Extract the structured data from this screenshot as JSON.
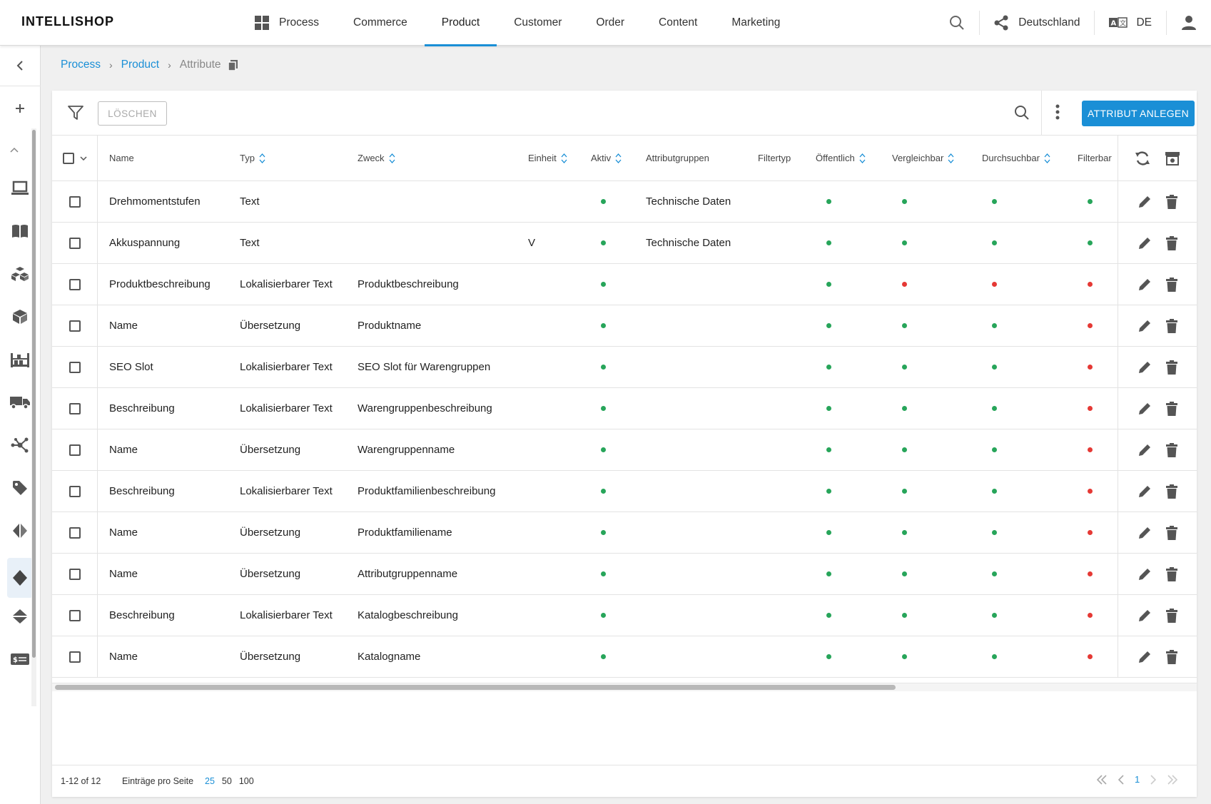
{
  "app": {
    "logo": "INTELLISHOP"
  },
  "nav": {
    "items": [
      {
        "label": "Process",
        "icon": "apps-grid-icon"
      },
      {
        "label": "Commerce"
      },
      {
        "label": "Product",
        "active": true
      },
      {
        "label": "Customer"
      },
      {
        "label": "Order"
      },
      {
        "label": "Content"
      },
      {
        "label": "Marketing"
      }
    ],
    "country": "Deutschland",
    "language": "DE"
  },
  "sidebar": {
    "icons": [
      "collapse-chevron-icon",
      "add-icon",
      "chevron-up-icon",
      "monitor-icon",
      "book-icon",
      "boxes-icon",
      "package-icon",
      "warehouse-icon",
      "truck-icon",
      "network-icon",
      "tag-icon",
      "attribute-group-icon",
      "attribute-icon",
      "variant-icon",
      "price-icon"
    ],
    "active": "attribute-icon"
  },
  "breadcrumb": {
    "items": [
      "Process",
      "Product"
    ],
    "current": "Attribute"
  },
  "toolbar": {
    "delete_label": "LÖSCHEN",
    "create_label": "ATTRIBUT ANLEGEN"
  },
  "table": {
    "columns": {
      "name": "Name",
      "typ": "Typ",
      "zweck": "Zweck",
      "einheit": "Einheit",
      "aktiv": "Aktiv",
      "attributgruppen": "Attributgruppen",
      "filtertyp": "Filtertyp",
      "oeffentlich": "Öffentlich",
      "vergleichbar": "Vergleichbar",
      "durchsuchbar": "Durchsuchbar",
      "filterbar": "Filterbar"
    },
    "rows": [
      {
        "name": "Drehmomentstufen",
        "typ": "Text",
        "zweck": "",
        "einheit": "",
        "aktiv": true,
        "attributgruppen": "Technische Daten",
        "filtertyp": "",
        "oeffentlich": true,
        "vergleichbar": true,
        "durchsuchbar": true,
        "filterbar": true
      },
      {
        "name": "Akkuspannung",
        "typ": "Text",
        "zweck": "",
        "einheit": "V",
        "aktiv": true,
        "attributgruppen": "Technische Daten",
        "filtertyp": "",
        "oeffentlich": true,
        "vergleichbar": true,
        "durchsuchbar": true,
        "filterbar": true
      },
      {
        "name": "Produktbeschreibung",
        "typ": "Lokalisierbarer Text",
        "zweck": "Produktbeschreibung",
        "einheit": "",
        "aktiv": true,
        "attributgruppen": "",
        "filtertyp": "",
        "oeffentlich": true,
        "vergleichbar": false,
        "durchsuchbar": false,
        "filterbar": false
      },
      {
        "name": "Name",
        "typ": "Übersetzung",
        "zweck": "Produktname",
        "einheit": "",
        "aktiv": true,
        "attributgruppen": "",
        "filtertyp": "",
        "oeffentlich": true,
        "vergleichbar": true,
        "durchsuchbar": true,
        "filterbar": false
      },
      {
        "name": "SEO Slot",
        "typ": "Lokalisierbarer Text",
        "zweck": "SEO Slot für Warengruppen",
        "einheit": "",
        "aktiv": true,
        "attributgruppen": "",
        "filtertyp": "",
        "oeffentlich": true,
        "vergleichbar": true,
        "durchsuchbar": true,
        "filterbar": false
      },
      {
        "name": "Beschreibung",
        "typ": "Lokalisierbarer Text",
        "zweck": "Warengruppenbeschreibung",
        "einheit": "",
        "aktiv": true,
        "attributgruppen": "",
        "filtertyp": "",
        "oeffentlich": true,
        "vergleichbar": true,
        "durchsuchbar": true,
        "filterbar": false
      },
      {
        "name": "Name",
        "typ": "Übersetzung",
        "zweck": "Warengruppenname",
        "einheit": "",
        "aktiv": true,
        "attributgruppen": "",
        "filtertyp": "",
        "oeffentlich": true,
        "vergleichbar": true,
        "durchsuchbar": true,
        "filterbar": false
      },
      {
        "name": "Beschreibung",
        "typ": "Lokalisierbarer Text",
        "zweck": "Produktfamilienbeschreibung",
        "einheit": "",
        "aktiv": true,
        "attributgruppen": "",
        "filtertyp": "",
        "oeffentlich": true,
        "vergleichbar": true,
        "durchsuchbar": true,
        "filterbar": false
      },
      {
        "name": "Name",
        "typ": "Übersetzung",
        "zweck": "Produktfamiliename",
        "einheit": "",
        "aktiv": true,
        "attributgruppen": "",
        "filtertyp": "",
        "oeffentlich": true,
        "vergleichbar": true,
        "durchsuchbar": true,
        "filterbar": false
      },
      {
        "name": "Name",
        "typ": "Übersetzung",
        "zweck": "Attributgruppenname",
        "einheit": "",
        "aktiv": true,
        "attributgruppen": "",
        "filtertyp": "",
        "oeffentlich": true,
        "vergleichbar": true,
        "durchsuchbar": true,
        "filterbar": false
      },
      {
        "name": "Beschreibung",
        "typ": "Lokalisierbarer Text",
        "zweck": "Katalogbeschreibung",
        "einheit": "",
        "aktiv": true,
        "attributgruppen": "",
        "filtertyp": "",
        "oeffentlich": true,
        "vergleichbar": true,
        "durchsuchbar": true,
        "filterbar": false
      },
      {
        "name": "Name",
        "typ": "Übersetzung",
        "zweck": "Katalogname",
        "einheit": "",
        "aktiv": true,
        "attributgruppen": "",
        "filtertyp": "",
        "oeffentlich": true,
        "vergleichbar": true,
        "durchsuchbar": true,
        "filterbar": false
      }
    ]
  },
  "footer": {
    "range": "1-12 of 12",
    "per_page_label": "Einträge pro Seite",
    "sizes": [
      "25",
      "50",
      "100"
    ],
    "active_size": "25",
    "current_page": "1"
  },
  "colors": {
    "accent": "#1a8fd6",
    "status_true": "#27a55a",
    "status_false": "#e53935"
  }
}
